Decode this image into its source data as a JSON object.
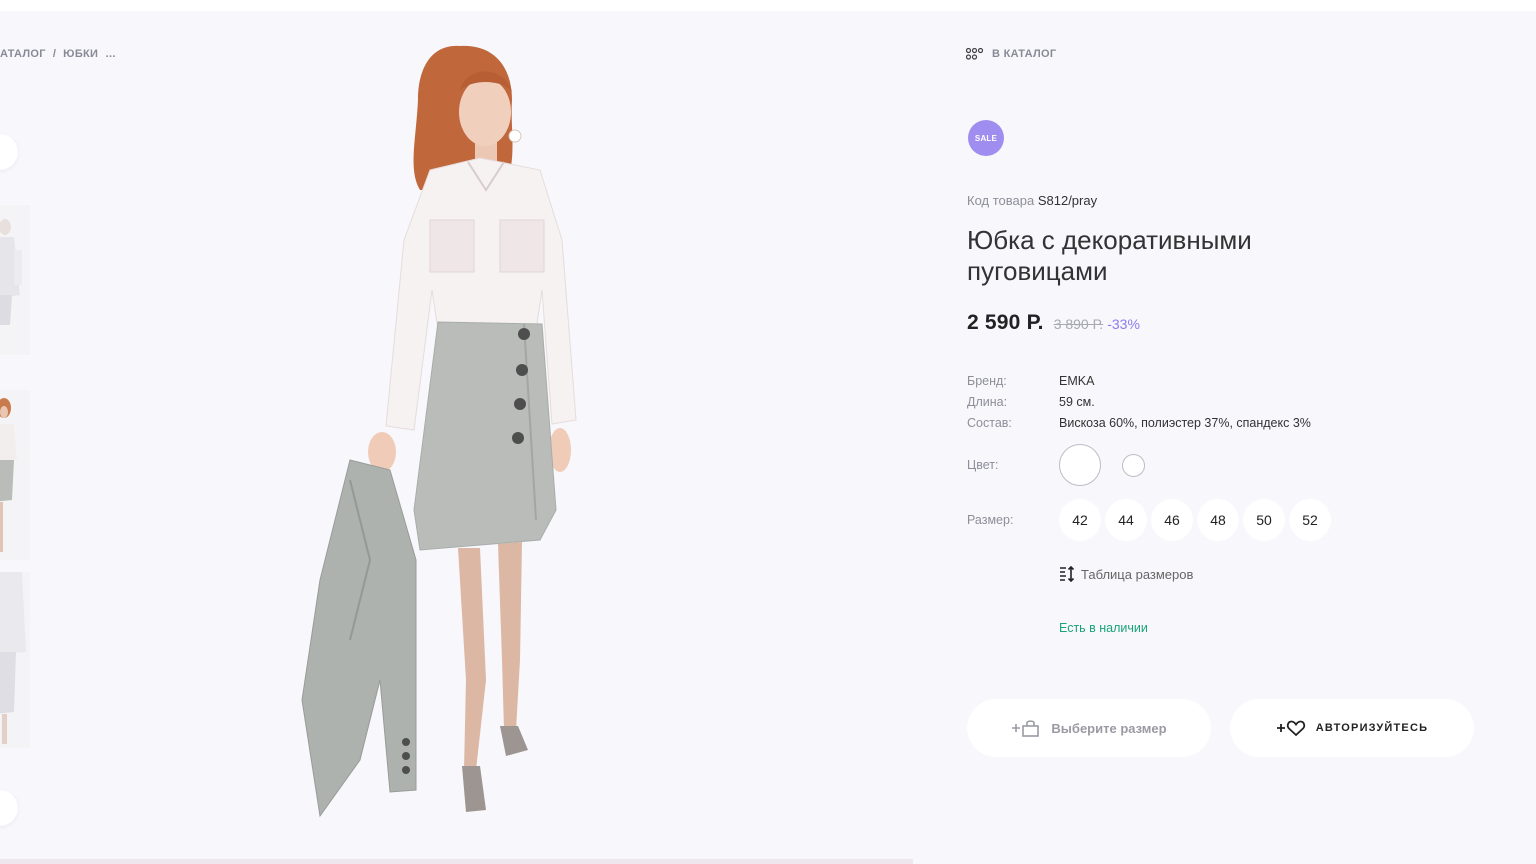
{
  "breadcrumb": {
    "items": [
      "АТАЛОГ",
      "ЮБКИ"
    ],
    "separator": "/",
    "more": "..."
  },
  "catalog_link": {
    "label": "В КАТАЛОГ",
    "icon": "grid-dots-icon"
  },
  "product": {
    "badge": "SALE",
    "sku_label": "Код товара",
    "sku_value": "S812/pray",
    "title": "Юбка с декоративными пуговицами",
    "price": "2 590 Р.",
    "old_price": "3 890 Р.",
    "discount": "-33%",
    "properties": [
      {
        "label": "Бренд:",
        "value": "EMKA"
      },
      {
        "label": "Длина:",
        "value": "59 см."
      },
      {
        "label": "Состав:",
        "value": "Вискоза 60%, полиэстер 37%, спандекс 3%"
      }
    ],
    "color_label": "Цвет:",
    "size_label": "Размер:",
    "sizes": [
      "42",
      "44",
      "46",
      "48",
      "50",
      "52"
    ],
    "size_table_label": "Таблица размеров",
    "stock_status": "Есть в наличии"
  },
  "actions": {
    "select_size_label": "Выберите размер",
    "auth_label": "АВТОРИЗУЙТЕСЬ"
  },
  "colors": {
    "background": "#f7f7fc",
    "sale_badge": "#9f8ef0",
    "discount": "#8c7cf0",
    "in_stock": "#1aa37a"
  }
}
